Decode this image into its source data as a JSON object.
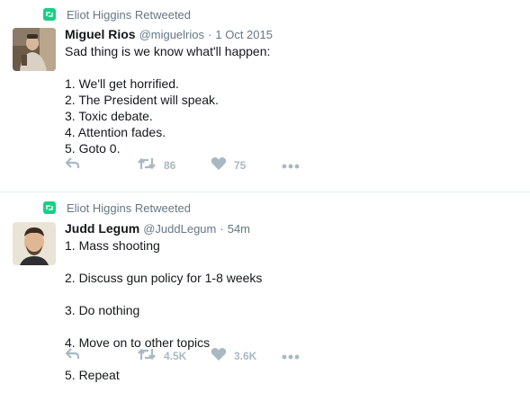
{
  "timeline": {
    "tweets": [
      {
        "retweet_context": "Eliot Higgins Retweeted",
        "fullname": "Miguel Rios",
        "username": "@miguelrios",
        "separator": "·",
        "time": "1 Oct 2015",
        "lines": [
          "Sad thing is we know what'll happen:",
          "",
          "1. We'll get horrified.",
          "2. The President will speak.",
          "3. Toxic debate.",
          "4. Attention fades.",
          "5. Goto 0."
        ],
        "retweets": "86",
        "likes": "75"
      },
      {
        "retweet_context": "Eliot Higgins Retweeted",
        "fullname": "Judd Legum",
        "username": "@JuddLegum",
        "separator": "·",
        "time": "54m",
        "lines": [
          "1. Mass shooting",
          "2. Discuss gun policy for 1-8 weeks",
          "3. Do nothing",
          "4. Move on to other topics",
          "5. Repeat"
        ],
        "retweets": "4.5K",
        "likes": "3.6K"
      }
    ]
  },
  "colors": {
    "retweet_badge": "#19cf86",
    "secondary_text": "#657786",
    "action_icon": "#aab8c2",
    "divider": "#e6ecf0"
  },
  "icons": [
    "retweet-badge-icon",
    "reply-icon",
    "retweet-icon",
    "like-icon",
    "more-icon"
  ]
}
